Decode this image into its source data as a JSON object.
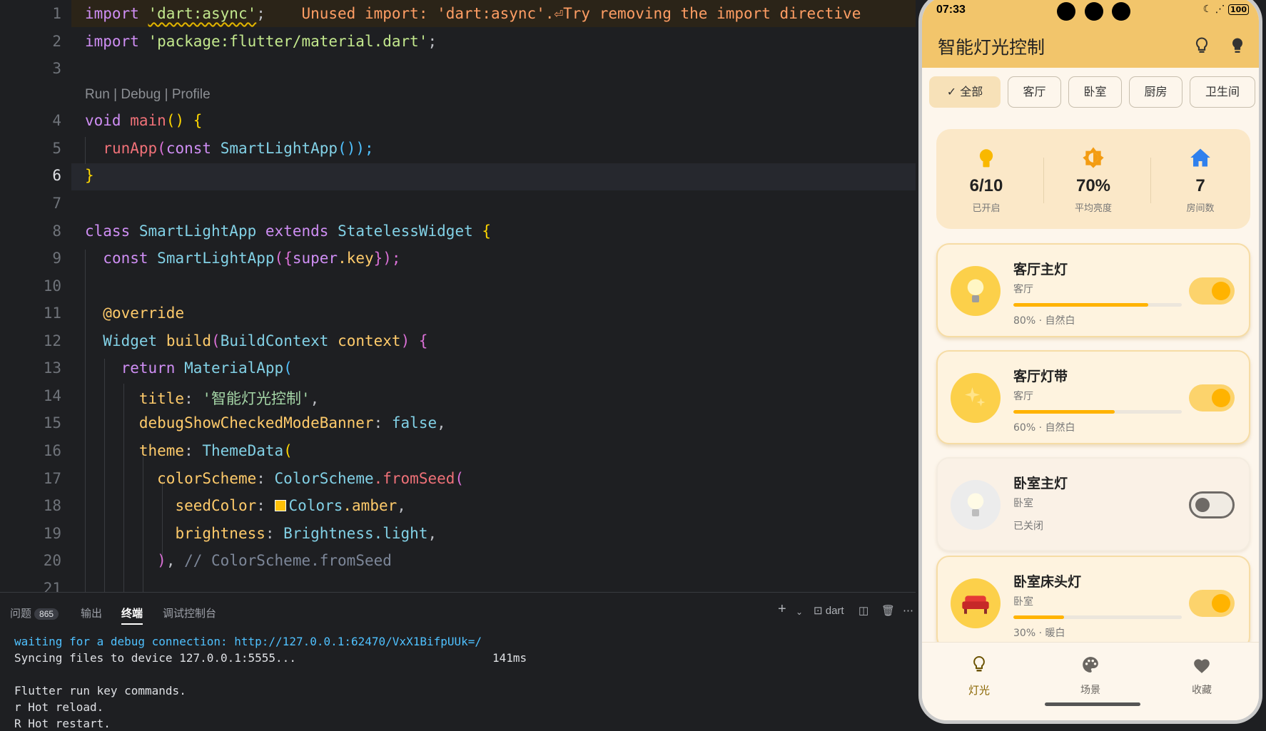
{
  "editor": {
    "line_numbers": [
      "1",
      "2",
      "3",
      "4",
      "5",
      "6",
      "7",
      "8",
      "9",
      "10",
      "11",
      "12",
      "13",
      "14",
      "15",
      "16",
      "17",
      "18",
      "19",
      "20",
      "21"
    ],
    "codelens": "Run | Debug | Profile",
    "lines": {
      "l1_kw": "import",
      "l1_str": "'dart:async'",
      "l1_semi": ";",
      "l1_hint": "Unused import: 'dart:async'.⏎Try removing the import directive",
      "l2_kw": "import",
      "l2_str": "'package:flutter/material.dart'",
      "l2_semi": ";",
      "l4_kw": "void",
      "l4_fn": "main",
      "l4_rest": "() {",
      "l5_fn": "runApp",
      "l5_kw": "const",
      "l5_cls": "SmartLightApp",
      "l5_rest": "());",
      "l6": "}",
      "l8_kw": "class",
      "l8_cls": "SmartLightApp",
      "l8_kw2": "extends",
      "l8_cls2": "StatelessWidget",
      "l8_br": "{",
      "l9_kw": "const",
      "l9_cls": "SmartLightApp",
      "l9_rest": "({",
      "l9_kw2": "super",
      "l9_prop": ".key",
      "l9_end": "});",
      "l11": "@override",
      "l12_cls": "Widget",
      "l12_fn": "build",
      "l12_cls2": "BuildContext",
      "l12_prop": "context",
      "l12_end": ") {",
      "l13_kw": "return",
      "l13_cls": "MaterialApp",
      "l13_br": "(",
      "l14_prop": "title",
      "l14_str": "'智能灯光控制'",
      "l15_prop": "debugShowCheckedModeBanner",
      "l15_val": "false",
      "l16_prop": "theme",
      "l16_cls": "ThemeData",
      "l16_br": "(",
      "l17_prop": "colorScheme",
      "l17_cls": "ColorScheme",
      "l17_fn": ".fromSeed",
      "l17_br": "(",
      "l18_prop": "seedColor",
      "l18_cls": "Colors",
      "l18_prop2": ".amber",
      "l19_prop": "brightness",
      "l19_cls": "Brightness",
      "l19_prop2": ".light",
      "l20_br": ")",
      "l20_cm": "// ColorScheme.fromSeed"
    }
  },
  "panel": {
    "tabs": [
      {
        "label": "问题",
        "badge": "865"
      },
      {
        "label": "输出"
      },
      {
        "label": "终端"
      },
      {
        "label": "调试控制台"
      }
    ],
    "toolbar": {
      "add": "+",
      "dropdown": "⌄",
      "terminal_name": "dart"
    },
    "terminal": {
      "line1": "waiting for a debug connection: http://127.0.0.1:62470/VxX1BifpUUk=/",
      "line2": "Syncing files to device 127.0.0.1:5555...",
      "line2_time": "141ms",
      "line3": "Flutter run key commands.",
      "line4": "r Hot reload.",
      "line5": "R Hot restart."
    }
  },
  "phone": {
    "status": {
      "time": "07:33",
      "battery": "100"
    },
    "app_title": "智能灯光控制",
    "filters": [
      "全部",
      "客厅",
      "卧室",
      "厨房",
      "卫生间"
    ],
    "filter_check": "✓",
    "summary": [
      {
        "value": "6/10",
        "label": "已开启",
        "icon": "bulb-icon"
      },
      {
        "value": "70%",
        "label": "平均亮度",
        "icon": "brightness-icon"
      },
      {
        "value": "7",
        "label": "房间数",
        "icon": "home-icon"
      }
    ],
    "lights": [
      {
        "name": "客厅主灯",
        "room": "客厅",
        "on": true,
        "brightness": 80,
        "info": "80% · 自然白",
        "icon": "bulb-icon"
      },
      {
        "name": "客厅灯带",
        "room": "客厅",
        "on": true,
        "brightness": 60,
        "info": "60% · 自然白",
        "icon": "sparkle-icon"
      },
      {
        "name": "卧室主灯",
        "room": "卧室",
        "on": false,
        "brightness": 0,
        "info": "已关闭",
        "icon": "bulb-icon"
      },
      {
        "name": "卧室床头灯",
        "room": "卧室",
        "on": true,
        "brightness": 30,
        "info": "30% · 暖白",
        "icon": "lamp-icon"
      }
    ],
    "nav": [
      {
        "label": "灯光",
        "icon": "bulb-outline-icon",
        "active": true
      },
      {
        "label": "场景",
        "icon": "palette-icon",
        "active": false
      },
      {
        "label": "收藏",
        "icon": "heart-icon",
        "active": false
      }
    ],
    "colors": {
      "accent": "#f2c56b",
      "on": "#ffb300",
      "card": "#fef3df"
    }
  }
}
